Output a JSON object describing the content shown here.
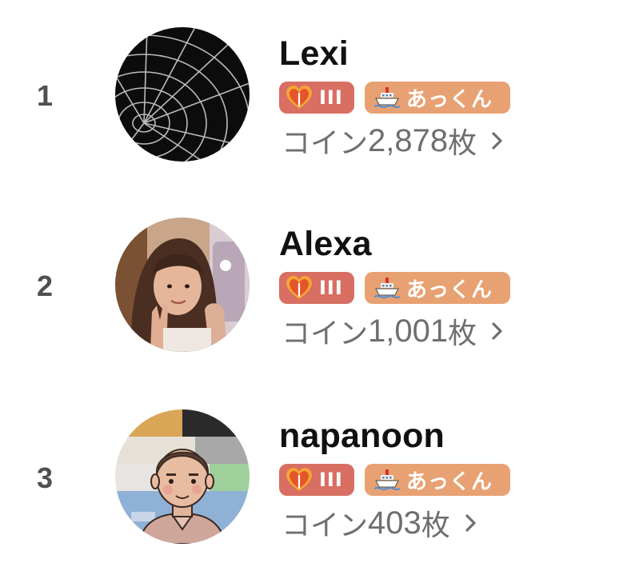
{
  "ranking": [
    {
      "rank": "1",
      "name": "Lexi",
      "level_badge": {
        "icon": "heart-icon",
        "label": "III",
        "color": "#d86f62"
      },
      "fan_badge": {
        "icon": "ship-icon",
        "label": "あっくん",
        "color": "#e8a172"
      },
      "coins": {
        "prefix": "コイン",
        "amount": "2,878",
        "suffix": "枚"
      },
      "avatar": "spider-web-avatar"
    },
    {
      "rank": "2",
      "name": "Alexa",
      "level_badge": {
        "icon": "heart-icon",
        "label": "III",
        "color": "#d86f62"
      },
      "fan_badge": {
        "icon": "ship-icon",
        "label": "あっくん",
        "color": "#e8a172"
      },
      "coins": {
        "prefix": "コイン",
        "amount": "1,001",
        "suffix": "枚"
      },
      "avatar": "selfie-photo-avatar"
    },
    {
      "rank": "3",
      "name": "napanoon",
      "level_badge": {
        "icon": "heart-icon",
        "label": "III",
        "color": "#d86f62"
      },
      "fan_badge": {
        "icon": "ship-icon",
        "label": "あっくん",
        "color": "#e8a172"
      },
      "coins": {
        "prefix": "コイン",
        "amount": "403",
        "suffix": "枚"
      },
      "avatar": "illustrated-man-avatar"
    }
  ],
  "colors": {
    "name_text": "#111111",
    "rank_text": "#505050",
    "coin_text": "#6f6f6f"
  }
}
